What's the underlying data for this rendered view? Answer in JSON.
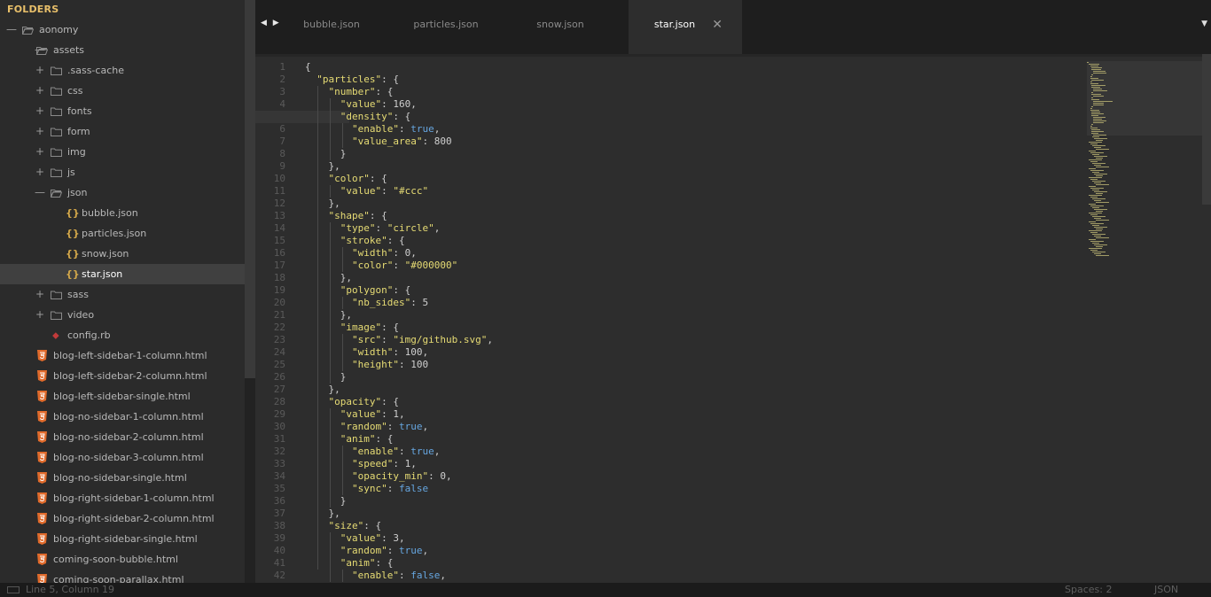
{
  "sidebar": {
    "header": "FOLDERS",
    "items": [
      {
        "label": "aonomy",
        "type": "folder",
        "toggle": "—",
        "depth": 0,
        "expanded": true
      },
      {
        "label": "assets",
        "type": "folder",
        "toggle": "—",
        "depth": 1,
        "expanded": true
      },
      {
        "label": ".sass-cache",
        "type": "folder",
        "toggle": "+",
        "depth": 2
      },
      {
        "label": "css",
        "type": "folder",
        "toggle": "+",
        "depth": 2
      },
      {
        "label": "fonts",
        "type": "folder",
        "toggle": "+",
        "depth": 2
      },
      {
        "label": "form",
        "type": "folder",
        "toggle": "+",
        "depth": 2
      },
      {
        "label": "img",
        "type": "folder",
        "toggle": "+",
        "depth": 2
      },
      {
        "label": "js",
        "type": "folder",
        "toggle": "+",
        "depth": 2
      },
      {
        "label": "json",
        "type": "folder",
        "toggle": "—",
        "depth": 2,
        "expanded": true
      },
      {
        "label": "bubble.json",
        "type": "json",
        "depth": 3
      },
      {
        "label": "particles.json",
        "type": "json",
        "depth": 3
      },
      {
        "label": "snow.json",
        "type": "json",
        "depth": 3
      },
      {
        "label": "star.json",
        "type": "json",
        "depth": 3,
        "selected": true
      },
      {
        "label": "sass",
        "type": "folder",
        "toggle": "+",
        "depth": 2
      },
      {
        "label": "video",
        "type": "folder",
        "toggle": "+",
        "depth": 2
      },
      {
        "label": "config.rb",
        "type": "ruby",
        "depth": 2
      },
      {
        "label": "blog-left-sidebar-1-column.html",
        "type": "html",
        "depth": 1
      },
      {
        "label": "blog-left-sidebar-2-column.html",
        "type": "html",
        "depth": 1
      },
      {
        "label": "blog-left-sidebar-single.html",
        "type": "html",
        "depth": 1
      },
      {
        "label": "blog-no-sidebar-1-column.html",
        "type": "html",
        "depth": 1
      },
      {
        "label": "blog-no-sidebar-2-column.html",
        "type": "html",
        "depth": 1
      },
      {
        "label": "blog-no-sidebar-3-column.html",
        "type": "html",
        "depth": 1
      },
      {
        "label": "blog-no-sidebar-single.html",
        "type": "html",
        "depth": 1
      },
      {
        "label": "blog-right-sidebar-1-column.html",
        "type": "html",
        "depth": 1
      },
      {
        "label": "blog-right-sidebar-2-column.html",
        "type": "html",
        "depth": 1
      },
      {
        "label": "blog-right-sidebar-single.html",
        "type": "html",
        "depth": 1
      },
      {
        "label": "coming-soon-bubble.html",
        "type": "html",
        "depth": 1
      },
      {
        "label": "coming-soon-parallax.html",
        "type": "html",
        "depth": 1
      }
    ]
  },
  "tabs": {
    "nav_arrows": "◀ ▶",
    "items": [
      {
        "label": "bubble.json"
      },
      {
        "label": "particles.json"
      },
      {
        "label": "snow.json"
      },
      {
        "label": "star.json",
        "active": true,
        "close": "✕"
      }
    ],
    "menu_icon": "▼"
  },
  "editor": {
    "current_line": 5,
    "lines": [
      "{",
      "  \"particles\": {",
      "    \"number\": {",
      "      \"value\": 160,",
      "      \"density\": {",
      "        \"enable\": true,",
      "        \"value_area\": 800",
      "      }",
      "    },",
      "    \"color\": {",
      "      \"value\": \"#ccc\"",
      "    },",
      "    \"shape\": {",
      "      \"type\": \"circle\",",
      "      \"stroke\": {",
      "        \"width\": 0,",
      "        \"color\": \"#000000\"",
      "      },",
      "      \"polygon\": {",
      "        \"nb_sides\": 5",
      "      },",
      "      \"image\": {",
      "        \"src\": \"img/github.svg\",",
      "        \"width\": 100,",
      "        \"height\": 100",
      "      }",
      "    },",
      "    \"opacity\": {",
      "      \"value\": 1,",
      "      \"random\": true,",
      "      \"anim\": {",
      "        \"enable\": true,",
      "        \"speed\": 1,",
      "        \"opacity_min\": 0,",
      "        \"sync\": false",
      "      }",
      "    },",
      "    \"size\": {",
      "      \"value\": 3,",
      "      \"random\": true,",
      "      \"anim\": {",
      "        \"enable\": false,"
    ]
  },
  "status": {
    "position": "Line 5, Column 19",
    "spaces": "Spaces: 2",
    "syntax": "JSON"
  },
  "colors": {
    "key": "#e6db74",
    "string": "#e6db74",
    "boolean": "#66a6e0",
    "folder_header": "#e8bf6a",
    "json_icon": "#d4a84a",
    "html_icon": "#e06a2b"
  }
}
